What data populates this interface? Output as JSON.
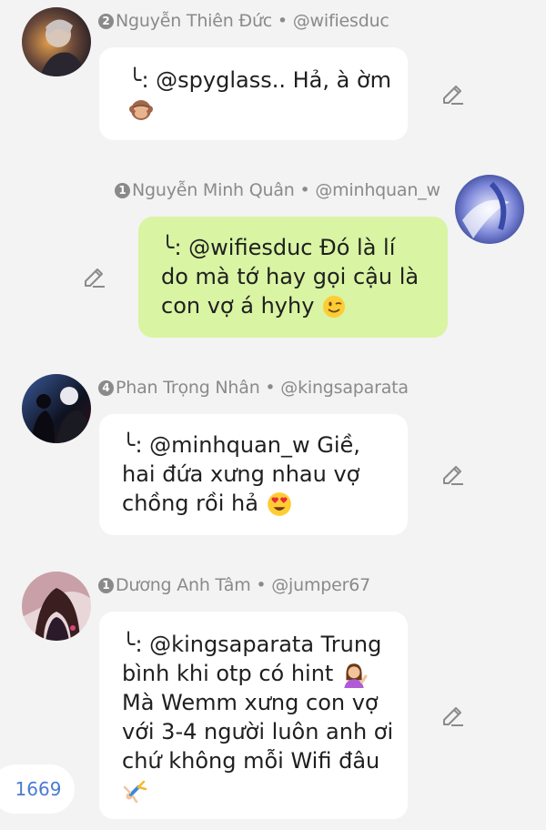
{
  "comments": [
    {
      "rank": "2",
      "name": "Nguyễn Thiên Đức",
      "separator": "•",
      "handle": "@wifiesduc",
      "lines": [
        "╰: @spyglass.. Hả, à ờm",
        ""
      ],
      "emoji": "see-no-evil-monkey"
    },
    {
      "rank": "1",
      "name": "Nguyễn Minh Quân",
      "separator": "•",
      "handle": "@minhquan_w",
      "lines": [
        "╰: @wifiesduc Đó là lí",
        "do mà tớ hay gọi cậu là",
        "con vợ á hyhy"
      ],
      "emoji": "winking-face"
    },
    {
      "rank": "4",
      "name": "Phan Trọng Nhân",
      "separator": "•",
      "handle": "@kingsaparata",
      "lines": [
        "╰: @minhquan_w Giề,",
        "hai đứa xưng nhau vợ",
        "chồng rồi hả"
      ],
      "emoji": "heart-eyes-face"
    },
    {
      "rank": "1",
      "name": "Dương Anh Tâm",
      "separator": "•",
      "handle": "@jumper67",
      "lines": [
        "╰: @kingsaparata Trung",
        "bình khi otp có hint",
        "Mà Wemm xưng con vợ",
        "với 3-4 người luôn anh ơi",
        "chứ không mỗi Wifi đâu",
        ""
      ],
      "emoji": "person-tipping-hand"
    }
  ],
  "comment_count": "1669",
  "colors": {
    "background": "#f3f3f3",
    "bubble_white": "#ffffff",
    "bubble_green": "#d9f4a3",
    "meta_text": "#8a8a8a",
    "count_text": "#4a7bd0"
  }
}
